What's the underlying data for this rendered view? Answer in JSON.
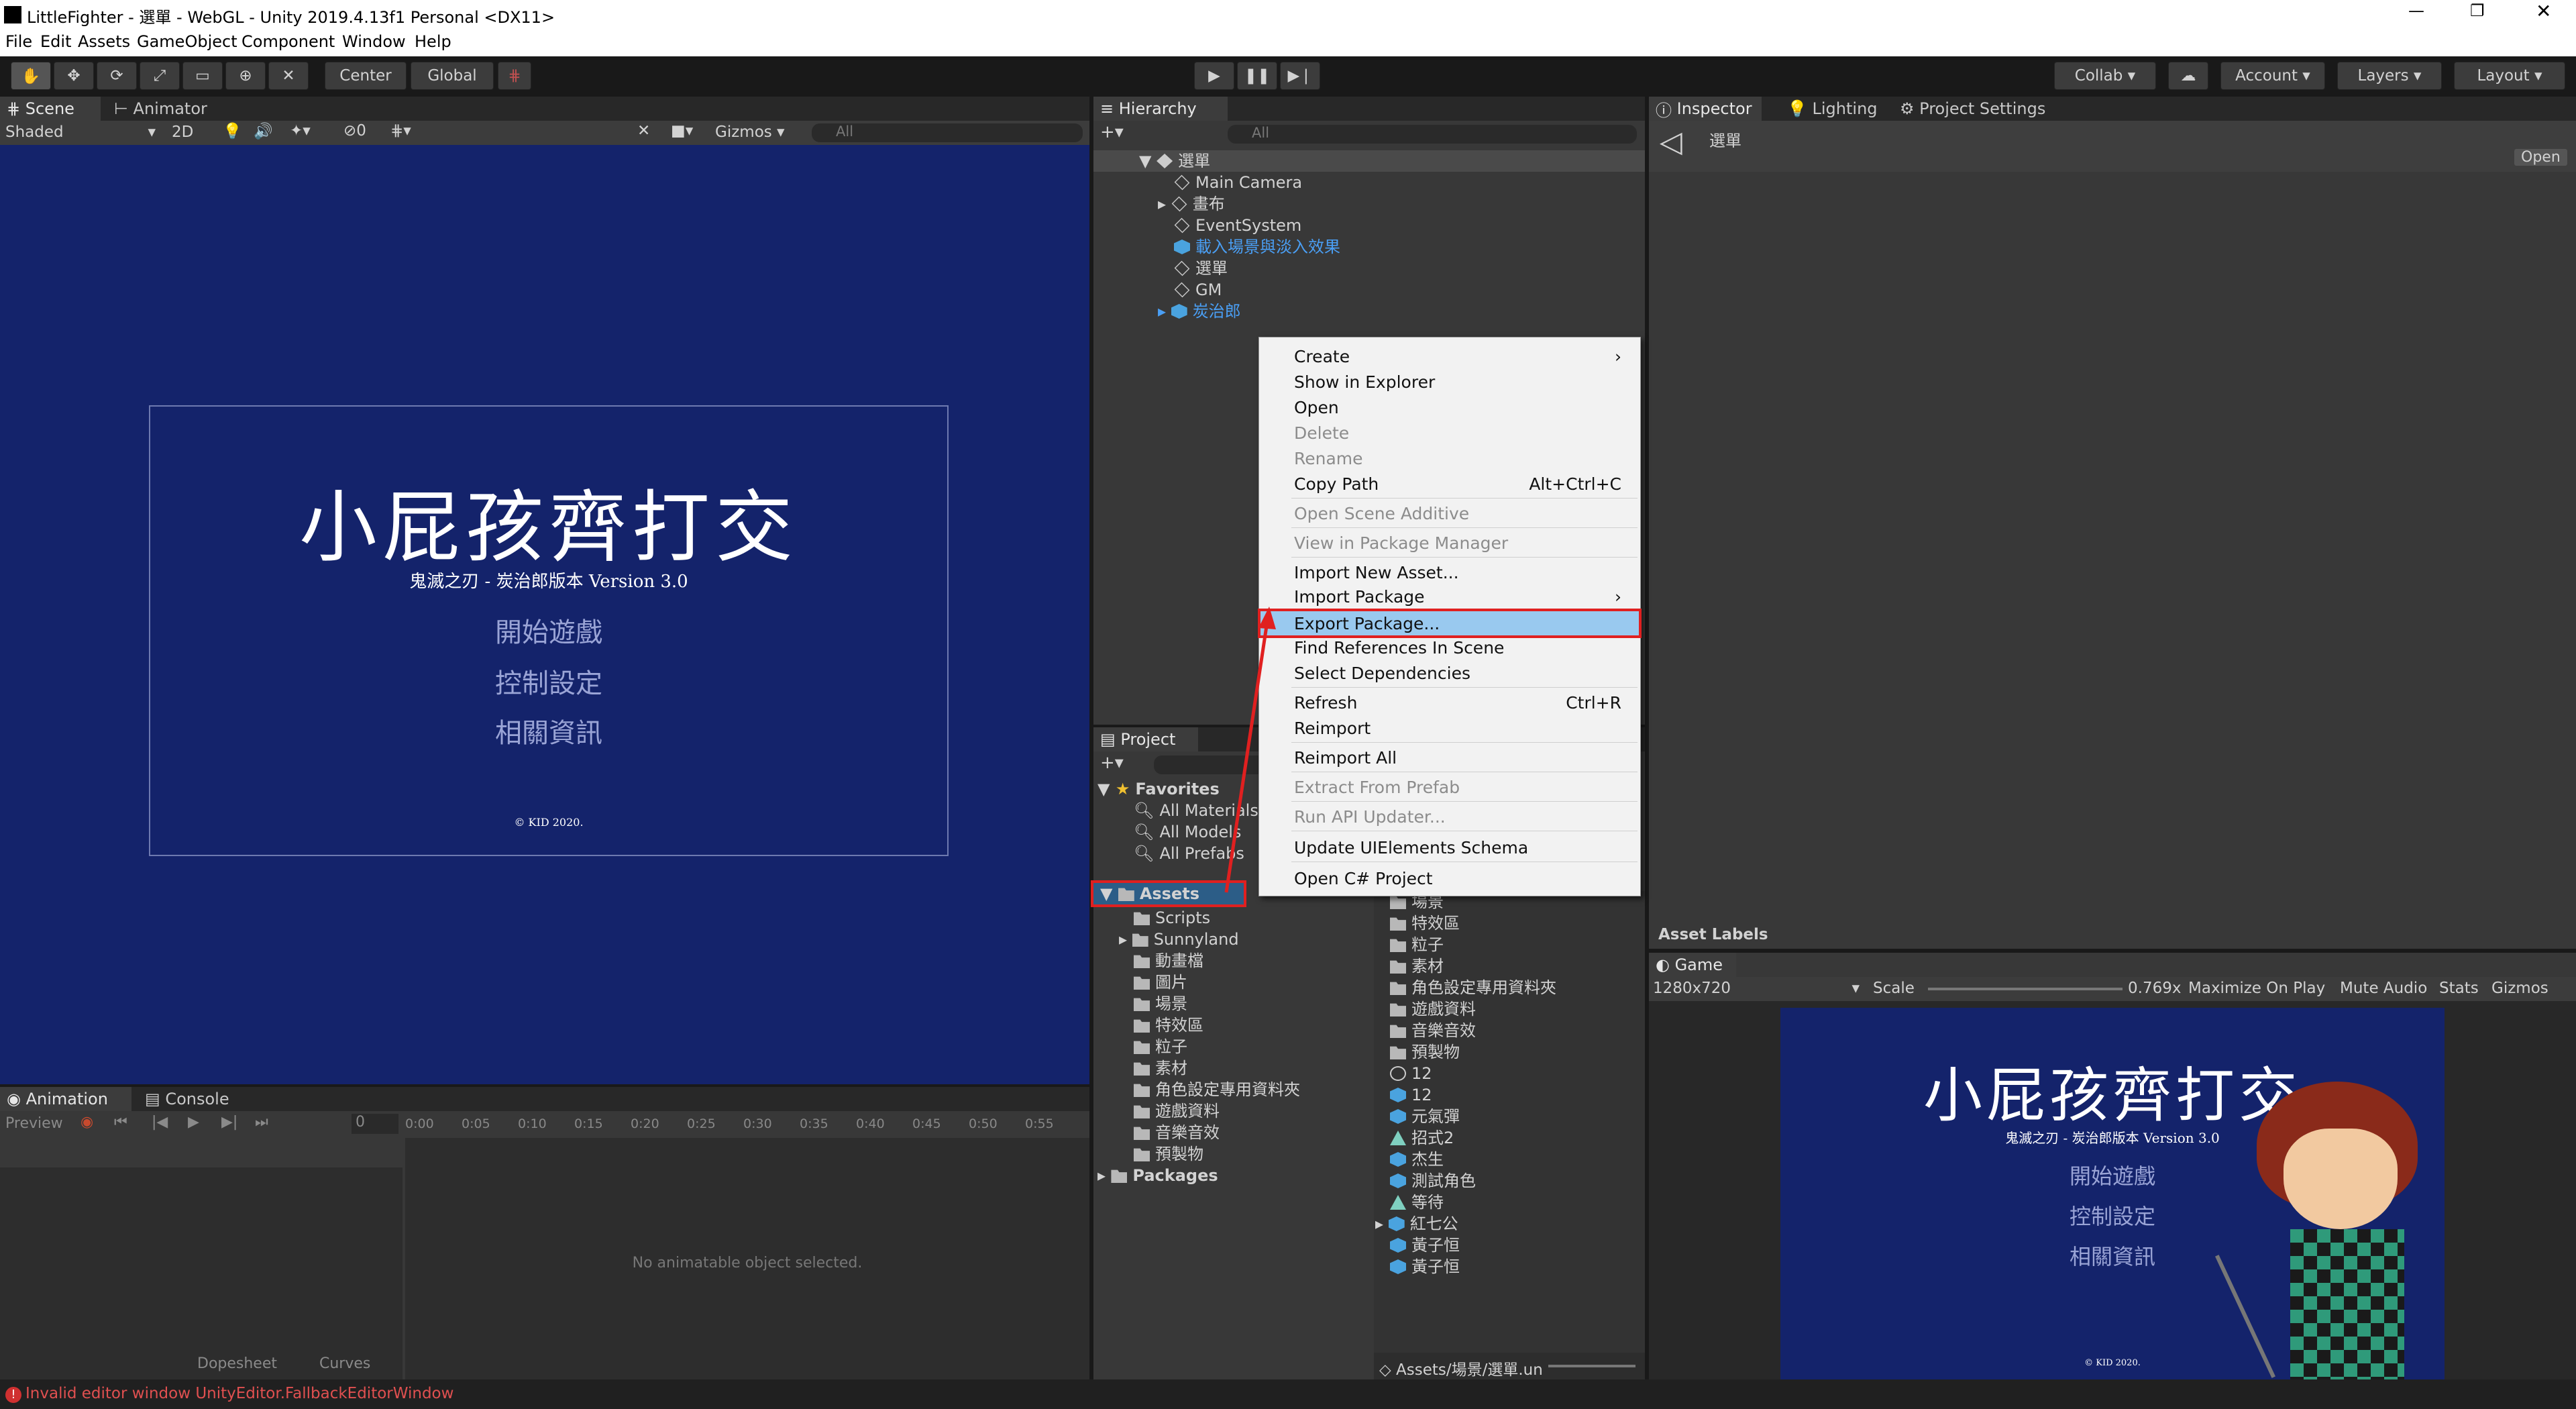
{
  "window": {
    "title": "LittleFighter - 選單 - WebGL - Unity 2019.4.13f1 Personal <DX11>"
  },
  "menubar": [
    "File",
    "Edit",
    "Assets",
    "GameObject",
    "Component",
    "Window",
    "Help"
  ],
  "toolbar": {
    "pivot": "Center",
    "space": "Global",
    "collab": "Collab ▾",
    "account": "Account",
    "layers": "Layers",
    "layout": "Layout"
  },
  "scene": {
    "tabs": [
      "Scene",
      "Animator"
    ],
    "shading": "Shaded",
    "mode_2d": "2D",
    "gizmos": "Gizmos",
    "search": "All",
    "fx_count": "0"
  },
  "game_view": {
    "title": "小屁孩齊打交",
    "subtitle": "鬼滅之刃 - 炭治郎版本 Version 3.0",
    "menu": [
      "開始遊戲",
      "控制設定",
      "相關資訊"
    ],
    "copyright": "© KID 2020."
  },
  "hierarchy": {
    "tab": "Hierarchy",
    "search": "All",
    "scene": "選單",
    "items": [
      "Main Camera",
      "畫布",
      "EventSystem",
      "載入場景與淡入效果",
      "選單",
      "GM",
      "炭治郎"
    ]
  },
  "context_menu": {
    "items": [
      {
        "label": "Create",
        "submenu": true
      },
      {
        "label": "Show in Explorer"
      },
      {
        "label": "Open"
      },
      {
        "label": "Delete",
        "disabled": true
      },
      {
        "label": "Rename",
        "disabled": true
      },
      {
        "label": "Copy Path",
        "shortcut": "Alt+Ctrl+C"
      },
      {
        "label": "Open Scene Additive",
        "disabled": true
      },
      {
        "label": "View in Package Manager",
        "disabled": true
      },
      {
        "label": "Import New Asset..."
      },
      {
        "label": "Import Package",
        "submenu": true
      },
      {
        "label": "Export Package...",
        "highlighted": true
      },
      {
        "label": "Find References In Scene"
      },
      {
        "label": "Select Dependencies"
      },
      {
        "label": "Refresh",
        "shortcut": "Ctrl+R"
      },
      {
        "label": "Reimport"
      },
      {
        "label": "Reimport All"
      },
      {
        "label": "Extract From Prefab",
        "disabled": true
      },
      {
        "label": "Run API Updater...",
        "disabled": true
      },
      {
        "label": "Update UIElements Schema"
      },
      {
        "label": "Open C# Project"
      }
    ]
  },
  "project": {
    "tab": "Project",
    "favorites_label": "Favorites",
    "favorites": [
      "All Materials",
      "All Models",
      "All Prefabs"
    ],
    "assets_label": "Assets",
    "asset_folders": [
      "Scripts",
      "Sunnyland",
      "動畫檔",
      "圖片",
      "場景",
      "特效區",
      "粒子",
      "素材",
      "角色設定專用資料夾",
      "遊戲資料",
      "音樂音效",
      "預製物"
    ],
    "packages_label": "Packages",
    "right_items": [
      "場景",
      "特效區",
      "粒子",
      "素材",
      "角色設定專用資料夾",
      "遊戲資料",
      "音樂音效",
      "預製物",
      "12",
      "12",
      "元氣彈",
      "招式2",
      "杰生",
      "測試角色",
      "等待",
      "紅七公",
      "黃子恒",
      "黃子恒"
    ],
    "path": "Assets/場景/選單.un"
  },
  "inspector": {
    "tabs": [
      "Inspector",
      "Lighting",
      "Project Settings"
    ],
    "object": "選單",
    "open_button": "Open",
    "asset_labels": "Asset Labels"
  },
  "game": {
    "tab": "Game",
    "resolution": "1280x720",
    "scale_label": "Scale",
    "scale_value": "0.769x",
    "maximize": "Maximize On Play",
    "mute": "Mute Audio",
    "stats": "Stats",
    "gizmos": "Gizmos"
  },
  "animation": {
    "tabs": [
      "Animation",
      "Console"
    ],
    "preview": "Preview",
    "frame": "0",
    "times": [
      "0:00",
      "0:05",
      "0:10",
      "0:15",
      "0:20",
      "0:25",
      "0:30",
      "0:35",
      "0:40",
      "0:45",
      "0:50",
      "0:55"
    ],
    "empty": "No animatable object selected.",
    "dopesheet": "Dopesheet",
    "curves": "Curves"
  },
  "status": {
    "error": "Invalid editor window UnityEditor.FallbackEditorWindow"
  },
  "colors": {
    "scene_bg": "#14236b",
    "highlight": "#99c9ef",
    "red": "#e02020",
    "link": "#4a9ff5"
  }
}
